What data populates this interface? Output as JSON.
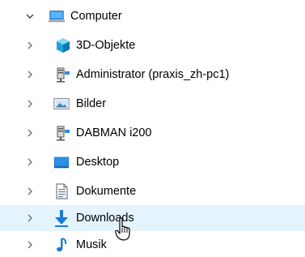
{
  "tree": {
    "root": {
      "label": "Computer",
      "icon": "computer-icon",
      "expanded": true
    },
    "items": [
      {
        "label": "3D-Objekte",
        "icon": "3d-objects-icon"
      },
      {
        "label": "Administrator (praxis_zh-pc1)",
        "icon": "network-drive-icon"
      },
      {
        "label": "Bilder",
        "icon": "pictures-icon"
      },
      {
        "label": "DABMAN  i200",
        "icon": "network-drive-icon"
      },
      {
        "label": "Desktop",
        "icon": "desktop-icon"
      },
      {
        "label": "Dokumente",
        "icon": "documents-icon"
      },
      {
        "label": "Downloads",
        "icon": "downloads-icon",
        "hovered": true
      },
      {
        "label": "Musik",
        "icon": "music-icon"
      }
    ]
  },
  "colors": {
    "hover_bg": "#e5f3ff",
    "accent_blue": "#1e7ad7",
    "chevron": "#707070"
  }
}
